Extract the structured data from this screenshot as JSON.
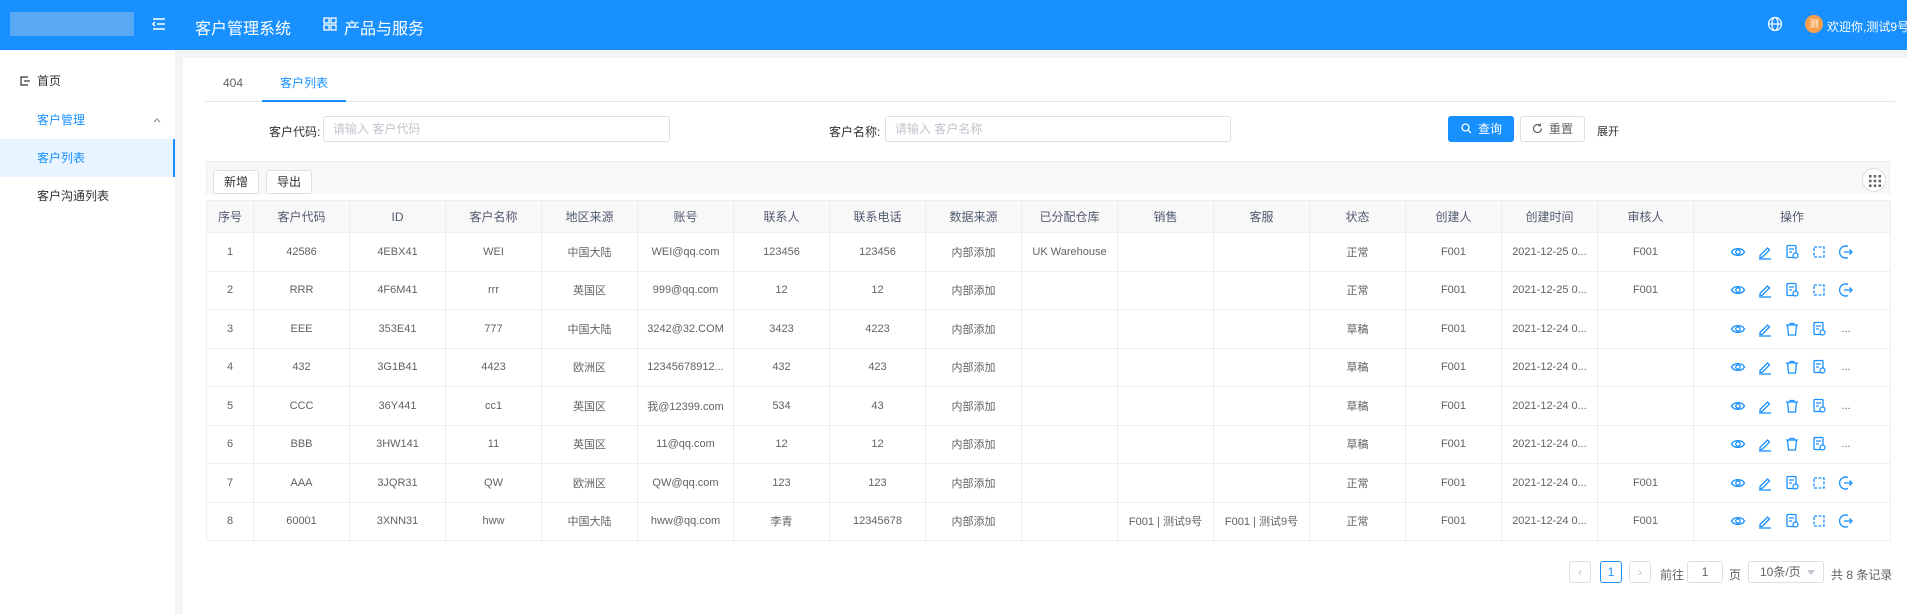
{
  "header": {
    "system_title": "客户管理系统",
    "product_menu": "产品与服务",
    "avatar_text": "测",
    "welcome": "欢迎你,测试9号",
    "brand_color": "#1890ff"
  },
  "sidebar": {
    "home": "首页",
    "group": "客户管理",
    "items": [
      {
        "label": "客户列表",
        "active": true
      },
      {
        "label": "客户沟通列表",
        "active": false
      }
    ]
  },
  "tabs": [
    {
      "label": "404",
      "active": false
    },
    {
      "label": "客户列表",
      "active": true
    }
  ],
  "search": {
    "code_label": "客户代码:",
    "code_placeholder": "请输入 客户代码",
    "name_label": "客户名称:",
    "name_placeholder": "请输入 客户名称",
    "query_label": "查询",
    "reset_label": "重置",
    "expand_label": "展开"
  },
  "toolbar": {
    "add_label": "新增",
    "export_label": "导出"
  },
  "table": {
    "columns": [
      "序号",
      "客户代码",
      "ID",
      "客户名称",
      "地区来源",
      "账号",
      "联系人",
      "联系电话",
      "数据来源",
      "已分配仓库",
      "销售",
      "客服",
      "状态",
      "创建人",
      "创建时间",
      "审核人",
      "操作"
    ],
    "rows": [
      {
        "no": "1",
        "code": "42586",
        "id": "4EBX41",
        "name": "WEI",
        "region": "中国大陆",
        "account": "WEI@qq.com",
        "contact": "123456",
        "phone": "123456",
        "source": "内部添加",
        "warehouse": "UK Warehouse",
        "sales": "",
        "service": "",
        "status": "正常",
        "creator": "F001",
        "created": "2021-12-25 0...",
        "auditor": "F001",
        "ops": "approved"
      },
      {
        "no": "2",
        "code": "RRR",
        "id": "4F6M41",
        "name": "rrr",
        "region": "英国区",
        "account": "999@qq.com",
        "contact": "12",
        "phone": "12",
        "source": "内部添加",
        "warehouse": "",
        "sales": "",
        "service": "",
        "status": "正常",
        "creator": "F001",
        "created": "2021-12-25 0...",
        "auditor": "F001",
        "ops": "approved"
      },
      {
        "no": "3",
        "code": "EEE",
        "id": "353E41",
        "name": "777",
        "region": "中国大陆",
        "account": "3242@32.COM",
        "contact": "3423",
        "phone": "4223",
        "source": "内部添加",
        "warehouse": "",
        "sales": "",
        "service": "",
        "status": "草稿",
        "creator": "F001",
        "created": "2021-12-24 0...",
        "auditor": "",
        "ops": "draft"
      },
      {
        "no": "4",
        "code": "432",
        "id": "3G1B41",
        "name": "4423",
        "region": "欧洲区",
        "account": "12345678912...",
        "contact": "432",
        "phone": "423",
        "source": "内部添加",
        "warehouse": "",
        "sales": "",
        "service": "",
        "status": "草稿",
        "creator": "F001",
        "created": "2021-12-24 0...",
        "auditor": "",
        "ops": "draft"
      },
      {
        "no": "5",
        "code": "CCC",
        "id": "36Y441",
        "name": "cc1",
        "region": "英国区",
        "account": "我@12399.com",
        "contact": "534",
        "phone": "43",
        "source": "内部添加",
        "warehouse": "",
        "sales": "",
        "service": "",
        "status": "草稿",
        "creator": "F001",
        "created": "2021-12-24 0...",
        "auditor": "",
        "ops": "draft"
      },
      {
        "no": "6",
        "code": "BBB",
        "id": "3HW141",
        "name": "11",
        "region": "英国区",
        "account": "11@qq.com",
        "contact": "12",
        "phone": "12",
        "source": "内部添加",
        "warehouse": "",
        "sales": "",
        "service": "",
        "status": "草稿",
        "creator": "F001",
        "created": "2021-12-24 0...",
        "auditor": "",
        "ops": "draft"
      },
      {
        "no": "7",
        "code": "AAA",
        "id": "3JQR31",
        "name": "QW",
        "region": "欧洲区",
        "account": "QW@qq.com",
        "contact": "123",
        "phone": "123",
        "source": "内部添加",
        "warehouse": "",
        "sales": "",
        "service": "",
        "status": "正常",
        "creator": "F001",
        "created": "2021-12-24 0...",
        "auditor": "F001",
        "ops": "approved"
      },
      {
        "no": "8",
        "code": "60001",
        "id": "3XNN31",
        "name": "hww",
        "region": "中国大陆",
        "account": "hww@qq.com",
        "contact": "李青",
        "phone": "12345678",
        "source": "内部添加",
        "warehouse": "",
        "sales": "F001 | 测试9号",
        "service": "F001 | 测试9号",
        "status": "正常",
        "creator": "F001",
        "created": "2021-12-24 0...",
        "auditor": "F001",
        "ops": "approved"
      }
    ],
    "more_label": "..."
  },
  "pagination": {
    "prev": "‹",
    "next": "›",
    "current_page": "1",
    "goto_prefix": "前往",
    "goto_value": "1",
    "goto_suffix": "页",
    "page_size": "10条/页",
    "total": "共 8 条记录"
  }
}
